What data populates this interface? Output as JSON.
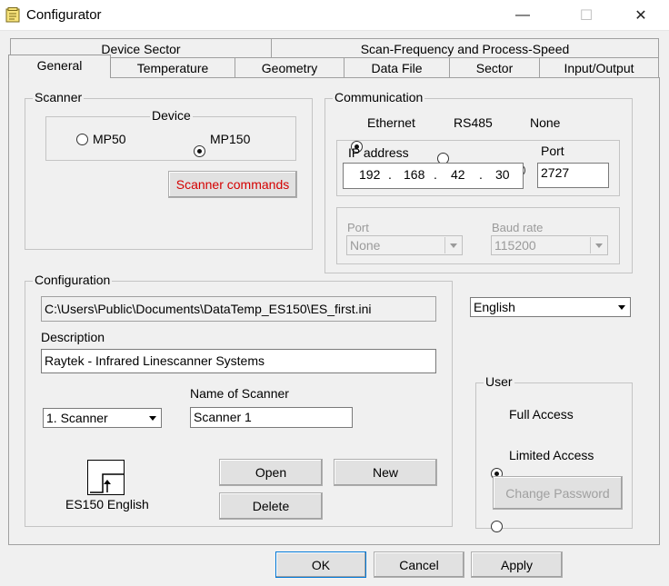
{
  "window": {
    "title": "Configurator",
    "minimize": "—",
    "maximize": "☐",
    "close": "✕"
  },
  "tabs": {
    "row1": [
      "Device Sector",
      "Scan-Frequency and Process-Speed"
    ],
    "row2": [
      "General",
      "Temperature",
      "Geometry",
      "Data File",
      "Sector",
      "Input/Output"
    ],
    "selected": "General"
  },
  "scanner": {
    "group_label": "Scanner",
    "device_label": "Device",
    "options": [
      "MP50",
      "MP150"
    ],
    "selected": "MP150",
    "commands_button": "Scanner commands",
    "commands_color": "#d40000"
  },
  "communication": {
    "group_label": "Communication",
    "options": [
      "Ethernet",
      "RS485",
      "None"
    ],
    "selected": "Ethernet",
    "ip_label": "IP address",
    "ip": [
      "192",
      "168",
      "42",
      "30"
    ],
    "ip_dot": ".",
    "port_label": "Port",
    "port": "2727",
    "serial_port_label": "Port",
    "serial_port_value": "None",
    "baud_label": "Baud rate",
    "baud_value": "115200"
  },
  "configuration": {
    "group_label": "Configuration",
    "path": "C:\\Users\\Public\\Documents\\DataTemp_ES150\\ES_first.ini",
    "description_label": "Description",
    "description": "Raytek - Infrared Linescanner Systems",
    "scanner_select": "1. Scanner",
    "name_label": "Name of Scanner",
    "name": "Scanner 1",
    "device_caption": "ES150 English",
    "open_button": "Open",
    "new_button": "New",
    "delete_button": "Delete"
  },
  "language": {
    "selected": "English"
  },
  "user": {
    "group_label": "User",
    "options": [
      "Full Access",
      "Limited Access"
    ],
    "selected": "Full Access",
    "change_password": "Change Password"
  },
  "footer": {
    "ok": "OK",
    "cancel": "Cancel",
    "apply": "Apply"
  }
}
